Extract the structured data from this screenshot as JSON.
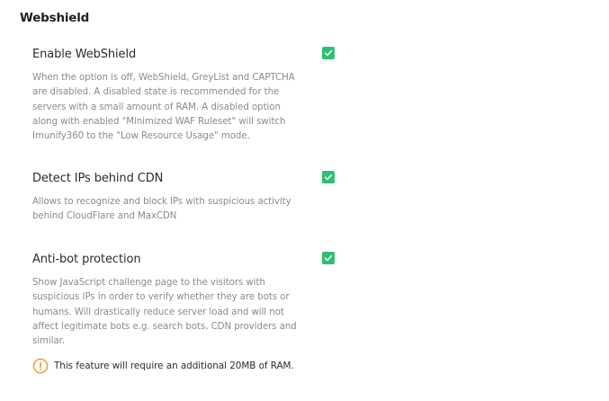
{
  "section": {
    "title": "Webshield"
  },
  "settings": [
    {
      "label": "Enable WebShield",
      "description": "When the option is off, WebShield, GreyList and CAPTCHA are disabled. A disabled state is recommended for the servers with a small amount of RAM. A disabled option along with enabled \"Minimized WAF Ruleset\" will switch Imunify360 to the \"Low Resource Usage\" mode.",
      "checked": true
    },
    {
      "label": "Detect IPs behind CDN",
      "description": "Allows to recognize and block IPs with suspicious activity behind CloudFlare and MaxCDN",
      "checked": true
    },
    {
      "label": "Anti-bot protection",
      "description": "Show JavaScript challenge page to the visitors with suspicious IPs in order to verify whether they are bots or humans. Will drastically reduce server load and will not affect legitimate bots e.g. search bots, CDN providers and similar.",
      "checked": true,
      "notice": {
        "icon": "info-icon",
        "text": "This feature will require an additional 20MB of RAM."
      }
    }
  ],
  "colors": {
    "checkbox": "#2fbf71",
    "notice_icon": "#f0a030",
    "description": "#8a8a8a"
  }
}
